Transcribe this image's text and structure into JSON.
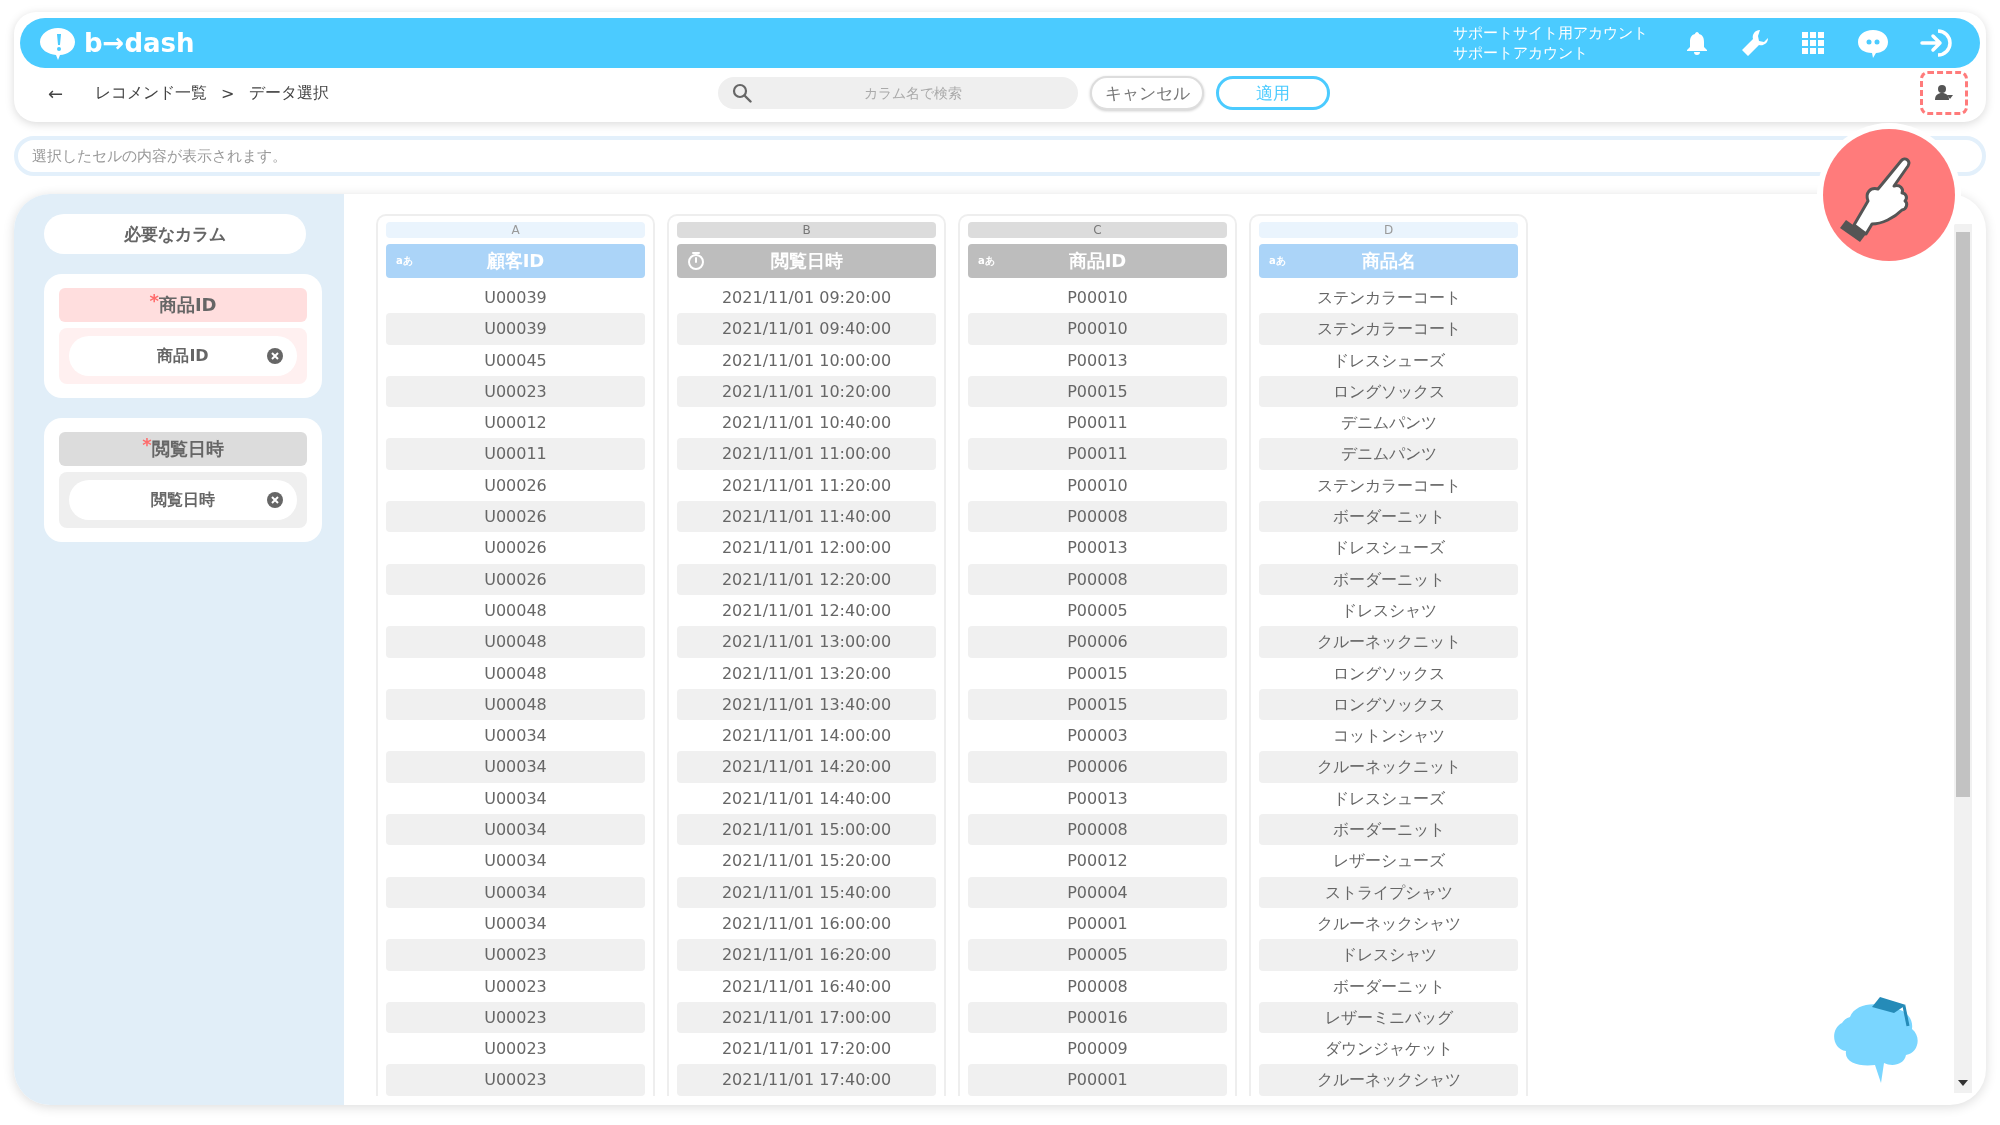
{
  "header": {
    "logo": "b→dash",
    "account_lines": [
      "サポートサイト用アカウント",
      "サポートアカウント"
    ]
  },
  "nav": {
    "back": "←",
    "breadcrumb": [
      "レコメンド一覧",
      "データ選択"
    ],
    "separator": ">",
    "search": {
      "placeholder": "カラム名で検索"
    },
    "buttons": [
      {
        "label": "キャンセル",
        "kind": "secondary"
      },
      {
        "label": "適用",
        "kind": "primary"
      }
    ]
  },
  "cell_content": {
    "placeholder": "選択したセルの内容が表示されます。"
  },
  "sidebar": {
    "title": "必要なカラム",
    "groups": [
      {
        "label": "商品ID",
        "required_mark": "*",
        "color": "#ffdede",
        "value": "商品ID"
      },
      {
        "label": "閲覧日時",
        "required_mark": "*",
        "color": "#dcdcdc",
        "value": "閲覧日時"
      }
    ]
  },
  "table": {
    "columns": [
      {
        "letter": "A",
        "name": "顧客ID",
        "kind": "text",
        "type_label": "aあ",
        "selected": true
      },
      {
        "letter": "B",
        "name": "閲覧日時",
        "kind": "datetime",
        "selected": false
      },
      {
        "letter": "C",
        "name": "商品ID",
        "kind": "text",
        "type_label": "aあ",
        "selected": false
      },
      {
        "letter": "D",
        "name": "商品名",
        "kind": "text",
        "type_label": "aあ",
        "selected": true
      }
    ],
    "rows": [
      [
        "U00039",
        "2021/11/01 09:20:00",
        "P00010",
        "ステンカラーコート"
      ],
      [
        "U00039",
        "2021/11/01 09:40:00",
        "P00010",
        "ステンカラーコート"
      ],
      [
        "U00045",
        "2021/11/01 10:00:00",
        "P00013",
        "ドレスシューズ"
      ],
      [
        "U00023",
        "2021/11/01 10:20:00",
        "P00015",
        "ロングソックス"
      ],
      [
        "U00012",
        "2021/11/01 10:40:00",
        "P00011",
        "デニムパンツ"
      ],
      [
        "U00011",
        "2021/11/01 11:00:00",
        "P00011",
        "デニムパンツ"
      ],
      [
        "U00026",
        "2021/11/01 11:20:00",
        "P00010",
        "ステンカラーコート"
      ],
      [
        "U00026",
        "2021/11/01 11:40:00",
        "P00008",
        "ボーダーニット"
      ],
      [
        "U00026",
        "2021/11/01 12:00:00",
        "P00013",
        "ドレスシューズ"
      ],
      [
        "U00026",
        "2021/11/01 12:20:00",
        "P00008",
        "ボーダーニット"
      ],
      [
        "U00048",
        "2021/11/01 12:40:00",
        "P00005",
        "ドレスシャツ"
      ],
      [
        "U00048",
        "2021/11/01 13:00:00",
        "P00006",
        "クルーネックニット"
      ],
      [
        "U00048",
        "2021/11/01 13:20:00",
        "P00015",
        "ロングソックス"
      ],
      [
        "U00048",
        "2021/11/01 13:40:00",
        "P00015",
        "ロングソックス"
      ],
      [
        "U00034",
        "2021/11/01 14:00:00",
        "P00003",
        "コットンシャツ"
      ],
      [
        "U00034",
        "2021/11/01 14:20:00",
        "P00006",
        "クルーネックニット"
      ],
      [
        "U00034",
        "2021/11/01 14:40:00",
        "P00013",
        "ドレスシューズ"
      ],
      [
        "U00034",
        "2021/11/01 15:00:00",
        "P00008",
        "ボーダーニット"
      ],
      [
        "U00034",
        "2021/11/01 15:20:00",
        "P00012",
        "レザーシューズ"
      ],
      [
        "U00034",
        "2021/11/01 15:40:00",
        "P00004",
        "ストライプシャツ"
      ],
      [
        "U00034",
        "2021/11/01 16:00:00",
        "P00001",
        "クルーネックシャツ"
      ],
      [
        "U00023",
        "2021/11/01 16:20:00",
        "P00005",
        "ドレスシャツ"
      ],
      [
        "U00023",
        "2021/11/01 16:40:00",
        "P00008",
        "ボーダーニット"
      ],
      [
        "U00023",
        "2021/11/01 17:00:00",
        "P00016",
        "レザーミニバッグ"
      ],
      [
        "U00023",
        "2021/11/01 17:20:00",
        "P00009",
        "ダウンジャケット"
      ],
      [
        "U00023",
        "2021/11/01 17:40:00",
        "P00001",
        "クルーネックシャツ"
      ]
    ]
  }
}
